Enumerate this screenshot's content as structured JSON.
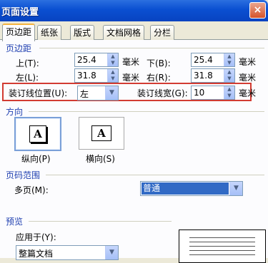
{
  "window": {
    "title": "页面设置",
    "close_label": "×"
  },
  "tabs": [
    {
      "label": "页边距",
      "active": true
    },
    {
      "label": "纸张",
      "active": false
    },
    {
      "label": "版式",
      "active": false
    },
    {
      "label": "文档网格",
      "active": false
    },
    {
      "label": "分栏",
      "active": false
    }
  ],
  "margins": {
    "section_label": "页边距",
    "top": {
      "label": "上(T):",
      "value": "25.4",
      "unit": "毫米"
    },
    "bottom": {
      "label": "下(B):",
      "value": "25.4",
      "unit": "毫米"
    },
    "left": {
      "label": "左(L):",
      "value": "31.8",
      "unit": "毫米"
    },
    "right": {
      "label": "右(R):",
      "value": "31.8",
      "unit": "毫米"
    },
    "gutter_position": {
      "label": "装订线位置(U):",
      "value": "左"
    },
    "gutter": {
      "label": "装订线宽(G):",
      "value": "10",
      "unit": "毫米"
    }
  },
  "orientation": {
    "section_label": "方向",
    "portrait_label": "纵向(P)",
    "landscape_label": "横向(S)",
    "glyph": "A",
    "selected": "portrait"
  },
  "pages": {
    "section_label": "页码范围",
    "multiple_label": "多页(M):",
    "multiple_value": "普通"
  },
  "preview": {
    "section_label": "预览",
    "apply_label": "应用于(Y):",
    "apply_value": "整篇文档"
  },
  "icons": {
    "spin_up": "▲",
    "spin_down": "▼",
    "dropdown": "▼"
  },
  "colors": {
    "title_bar": "#0a4fd1",
    "highlight": "#d23b32",
    "section": "#1f3fb0",
    "selected": "#316ac5"
  }
}
